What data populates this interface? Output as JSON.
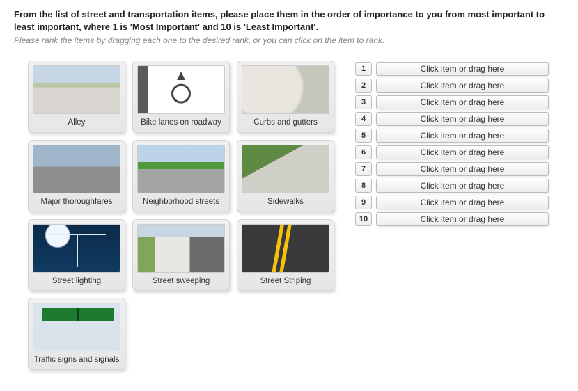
{
  "question": {
    "title": "From the list of street and transportation items, please place them in the order of importance to you from most important to least important, where 1 is 'Most Important' and 10 is 'Least Important'.",
    "hint": "Please rank the items by dragging each one to the desired rank, or you can click on the item to rank."
  },
  "items": [
    {
      "label": "Alley",
      "thumb_class": "th-alley"
    },
    {
      "label": "Bike lanes on roadway",
      "thumb_class": "th-bike"
    },
    {
      "label": "Curbs and gutters",
      "thumb_class": "th-curb"
    },
    {
      "label": "Major thoroughfares",
      "thumb_class": "th-major"
    },
    {
      "label": "Neighborhood streets",
      "thumb_class": "th-neigh"
    },
    {
      "label": "Sidewalks",
      "thumb_class": "th-sidewalk"
    },
    {
      "label": "Street lighting",
      "thumb_class": "th-light"
    },
    {
      "label": "Street sweeping",
      "thumb_class": "th-sweep"
    },
    {
      "label": "Street Striping",
      "thumb_class": "th-stripe"
    },
    {
      "label": "Traffic signs and signals",
      "thumb_class": "th-signs"
    }
  ],
  "rank_slot_placeholder": "Click item or drag here",
  "ranks": [
    1,
    2,
    3,
    4,
    5,
    6,
    7,
    8,
    9,
    10
  ]
}
